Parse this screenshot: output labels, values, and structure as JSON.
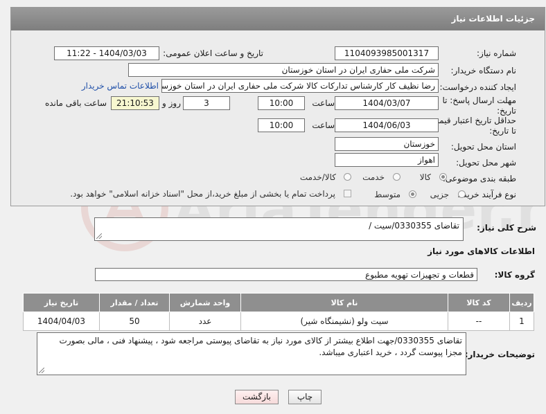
{
  "header": {
    "title": "جزئیات اطلاعات نیاز"
  },
  "form": {
    "need_number": {
      "label": "شماره نیاز:",
      "value": "1104093985001317"
    },
    "announce": {
      "label": "تاریخ و ساعت اعلان عمومی:",
      "value": "1404/03/03 - 11:22"
    },
    "buyer_org": {
      "label": "نام دستگاه خریدار:",
      "value": "شرکت ملی حفاری ایران در استان خوزستان"
    },
    "requester": {
      "label": "ایجاد کننده درخواست:",
      "value": "رضا نظیف کار کارشناس تدارکات کالا شرکت ملی حفاری ایران در استان خوزستان",
      "contact_link": "اطلاعات تماس خریدار"
    },
    "deadline": {
      "label_line1": "مهلت ارسال پاسخ: تا",
      "label_line2": "تاریخ:",
      "date": "1404/03/07",
      "time_label": "ساعت",
      "time": "10:00",
      "days": "3",
      "days_label": "روز و",
      "remaining": "21:10:53",
      "remaining_label": "ساعت باقی مانده"
    },
    "price_validity": {
      "label_line1": "حداقل تاریخ اعتبار قیمت:",
      "label_line2": "تا تاریخ:",
      "date": "1404/06/03",
      "time_label": "ساعت",
      "time": "10:00"
    },
    "delivery_province": {
      "label": "استان محل تحویل:",
      "value": "خوزستان"
    },
    "delivery_city": {
      "label": "شهر محل تحویل:",
      "value": "اهواز"
    },
    "category": {
      "label": "طبقه بندی موضوعی:",
      "options": [
        "کالا",
        "خدمت",
        "کالا/خدمت"
      ],
      "selected": "کالا"
    },
    "purchase_type": {
      "label": "نوع فرآیند خرید :",
      "options": [
        "جزیی",
        "متوسط"
      ],
      "selected": "متوسط",
      "note": "پرداخت تمام یا بخشی از مبلغ خرید،از محل \"اسناد خزانه اسلامی\" خواهد بود."
    }
  },
  "description": {
    "label": "شرح کلی نیاز:",
    "value": "تقاضای 0330355/سیت /"
  },
  "goods_section": {
    "title": "اطلاعات کالاهای مورد نیاز"
  },
  "goods_group": {
    "label": "گروه کالا:",
    "value": "قطعات و تجهیزات تهویه مطبوع"
  },
  "table": {
    "headers": [
      "ردیف",
      "کد کالا",
      "نام کالا",
      "واحد شمارش",
      "تعداد / مقدار",
      "تاریخ نیاز"
    ],
    "rows": [
      {
        "row": "1",
        "code": "--",
        "name": "سیت ولو (نشیمنگاه شیر)",
        "unit": "عدد",
        "qty": "50",
        "date": "1404/04/03"
      }
    ]
  },
  "buyer_notes": {
    "label": "توضیحات خریدار:",
    "value": "تقاضای 0330355/جهت اطلاع بیشتر از کالای مورد نیاز به تقاضای پیوستی مراجعه شود ، پیشنهاد فنی ، مالی بصورت مجزا پیوست گردد ، خرید اعتباری میباشد."
  },
  "buttons": {
    "print": "چاپ",
    "back": "بازگشت"
  },
  "watermark": {
    "text": "AriaTender.neT"
  },
  "colors": {
    "header_bg": "#8a8a8a",
    "link": "#1f4fa8",
    "back_button": "#f6dada"
  }
}
